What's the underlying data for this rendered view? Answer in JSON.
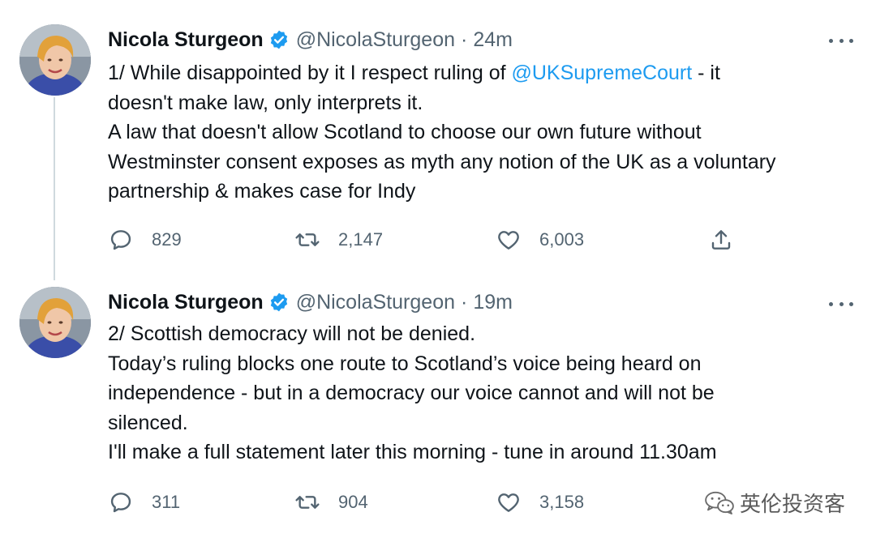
{
  "tweets": [
    {
      "author_name": "Nicola Sturgeon",
      "handle": "@NicolaSturgeon",
      "separator": "·",
      "time": "24m",
      "lines": [
        {
          "before": "1/ While disappointed by it I respect ruling of ",
          "mention": "@UKSupremeCourt",
          "after": " - it"
        },
        {
          "text": "doesn't make law, only interprets it."
        },
        {
          "text": "A law that doesn't allow Scotland to choose our own future without"
        },
        {
          "text": "Westminster consent exposes as myth any notion of the UK as a voluntary"
        },
        {
          "text": "partnership & makes case for Indy"
        }
      ],
      "replies": "829",
      "retweets": "2,147",
      "likes": "6,003"
    },
    {
      "author_name": "Nicola Sturgeon",
      "handle": "@NicolaSturgeon",
      "separator": "·",
      "time": "19m",
      "lines": [
        {
          "text": "2/ Scottish democracy will not be denied."
        },
        {
          "text": "Today’s ruling blocks one route to Scotland’s voice being heard on"
        },
        {
          "text": "independence - but in a democracy our voice cannot and will not be"
        },
        {
          "text": "silenced."
        },
        {
          "text": "I'll make a full statement later this morning - tune in around 11.30am"
        }
      ],
      "replies": "311",
      "retweets": "904",
      "likes": "3,158"
    }
  ],
  "watermark": {
    "text": "英伦投资客",
    "icon": "wechat-icon"
  },
  "colors": {
    "accent": "#1d9bf0",
    "secondary_text": "#536471",
    "primary_text": "#0f1419",
    "thread_line": "#cfd9de"
  },
  "icons": {
    "verified": "verified-badge-icon",
    "more": "more-options-icon",
    "reply": "reply-icon",
    "retweet": "retweet-icon",
    "like": "heart-icon",
    "share": "share-icon"
  }
}
